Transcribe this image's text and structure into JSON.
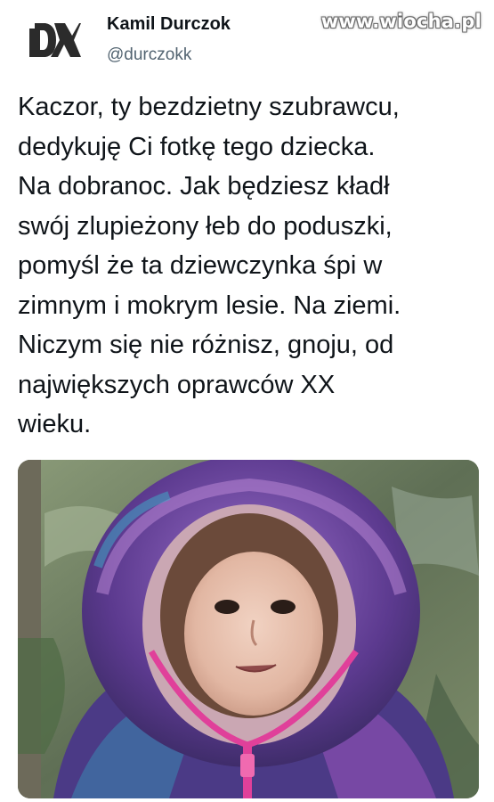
{
  "author": {
    "name": "Kamil Durczok",
    "handle": "@durczokk",
    "avatar_icon": "dk-monogram-logo",
    "avatar_text": "DK"
  },
  "watermark": "www.wiocha.pl",
  "tweet": {
    "lines": [
      "Kaczor, ty bezdzietny szubrawcu,",
      "dedykuję Ci fotkę tego dziecka.",
      "Na dobranoc. Jak będziesz kładł",
      "swój zlupieżony łeb do poduszki,",
      "pomyśl że ta dziewczynka śpi w",
      "zimnym i mokrym lesie. Na ziemi.",
      "Niczym się nie różnisz, gnoju, od",
      "największych oprawców XX",
      "wieku."
    ]
  },
  "media": {
    "icon": "photo-child-in-purple-hooded-jacket"
  },
  "colors": {
    "text": "#0f1419",
    "secondary_text": "#536471",
    "background": "#ffffff",
    "jacket_purple": "#6b3fa0",
    "zipper_pink": "#e0409a"
  }
}
